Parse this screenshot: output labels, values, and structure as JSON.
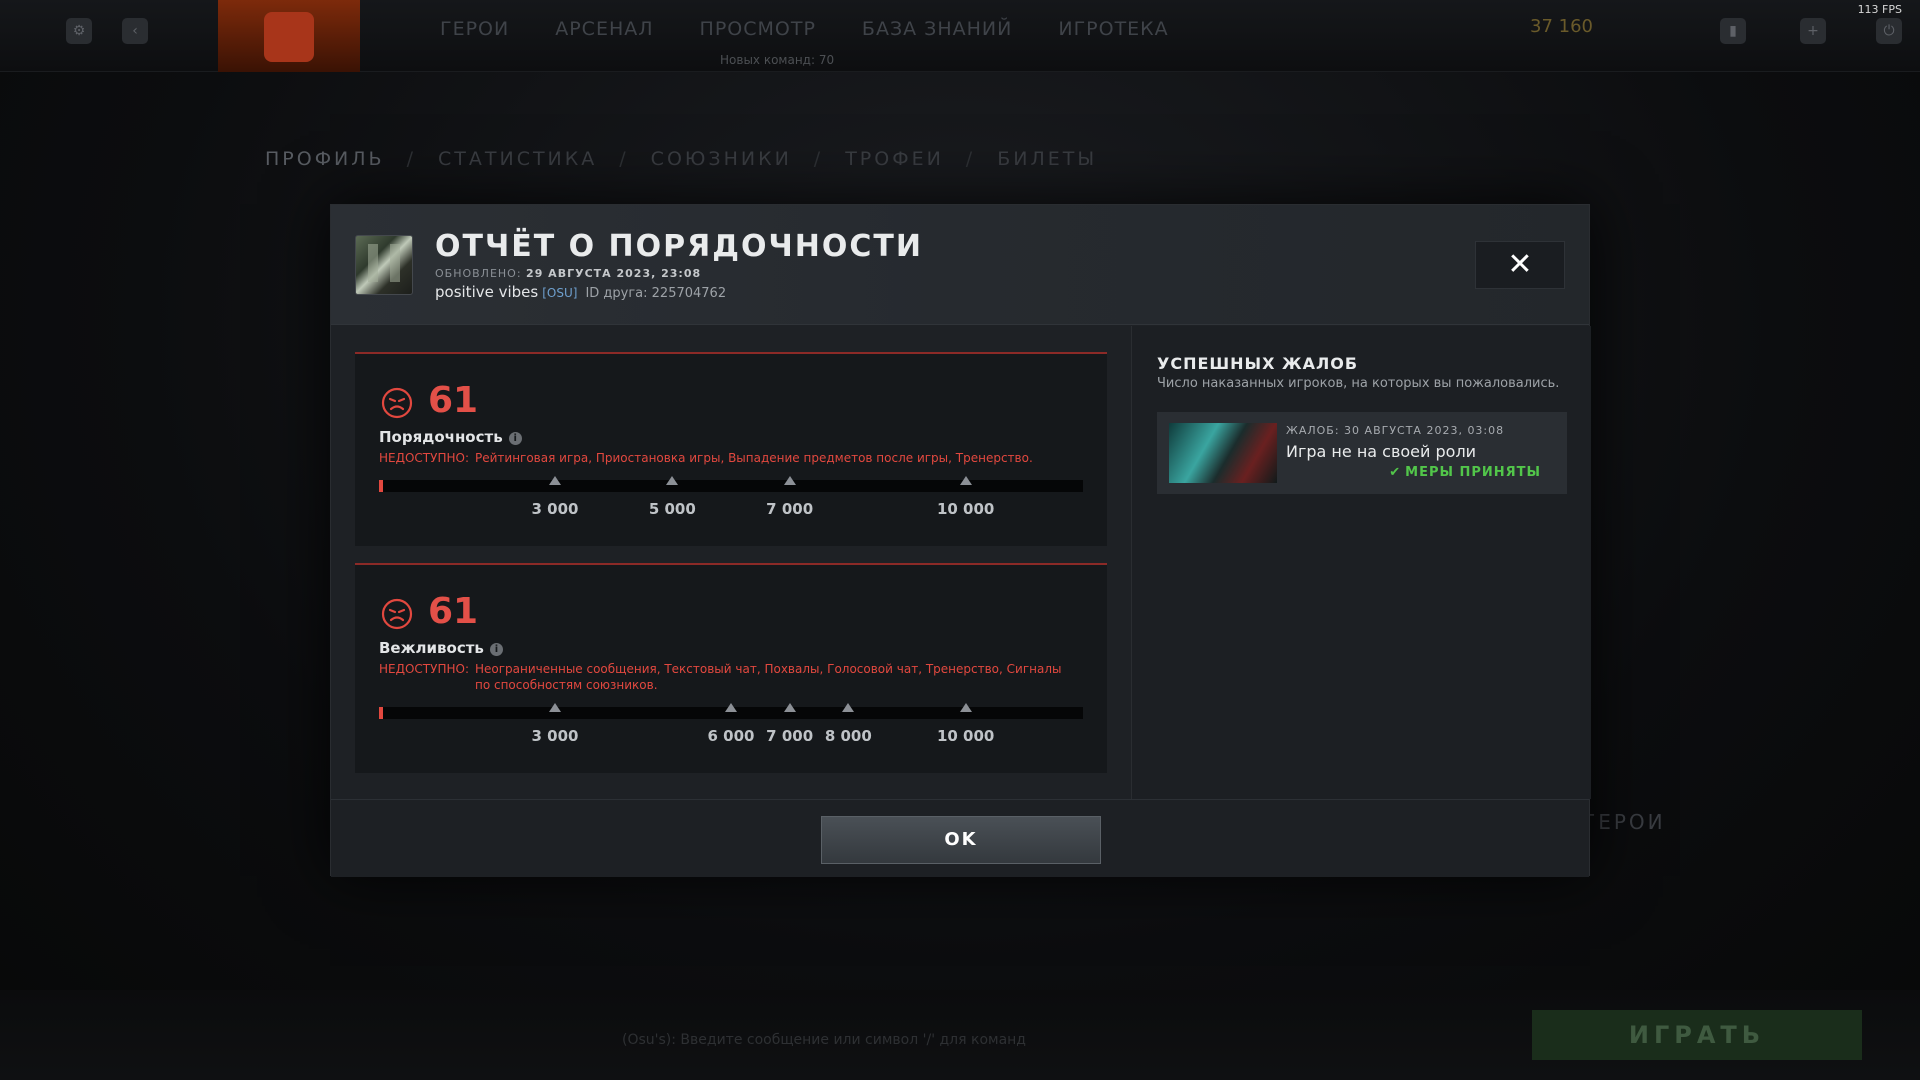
{
  "fps": "113 FPS",
  "background": {
    "nav": [
      "ГЕРОИ",
      "АРСЕНАЛ",
      "ПРОСМОТР",
      "БАЗА ЗНАНИЙ",
      "ИГРОТЕКА"
    ],
    "coins": "37  160",
    "new_teams": "Новых команд: 70",
    "profile_tabs": [
      "ПРОФИЛЬ",
      "СТАТИСТИКА",
      "СОЮЗНИКИ",
      "ТРОФЕИ",
      "БИЛЕТЫ"
    ],
    "heroes_title": "ГЕРОИ",
    "play_label": "ИГРАТЬ",
    "chat_placeholder": "(Osu's): Введите сообщение или символ '/' для команд"
  },
  "modal": {
    "title": "ОТЧЁТ О ПОРЯДОЧНОСТИ",
    "updated_label": "ОБНОВЛЕНО:",
    "updated_value": "29 АВГУСТА 2023, 23:08",
    "player_name": "positive vibes",
    "player_tag": "[OSU]",
    "friend_id": "ID друга: 225704762",
    "close_label": "✕",
    "ok_label": "OK"
  },
  "behavior": {
    "score": "61",
    "label": "Порядочность",
    "unavailable_label": "НЕДОСТУПНО:",
    "unavailable_text": "Рейтинговая игра, Приостановка игры, Выпадение предметов после игры, Тренерство.",
    "max": 12000,
    "value": 61,
    "ticks": [
      {
        "value": 3000,
        "label": "3 000"
      },
      {
        "value": 5000,
        "label": "5 000"
      },
      {
        "value": 7000,
        "label": "7 000"
      },
      {
        "value": 10000,
        "label": "10 000"
      }
    ]
  },
  "communication": {
    "score": "61",
    "label": "Вежливость",
    "unavailable_label": "НЕДОСТУПНО:",
    "unavailable_text": "Неограниченные сообщения, Текстовый чат, Похвалы, Голосовой чат, Тренерство, Сигналы по способностям союзников.",
    "max": 12000,
    "value": 61,
    "ticks": [
      {
        "value": 3000,
        "label": "3 000"
      },
      {
        "value": 6000,
        "label": "6 000"
      },
      {
        "value": 7000,
        "label": "7 000"
      },
      {
        "value": 8000,
        "label": "8 000"
      },
      {
        "value": 10000,
        "label": "10 000"
      }
    ]
  },
  "reports": {
    "title": "УСПЕШНЫХ ЖАЛОБ",
    "subtitle": "Число наказанных игроков, на которых вы пожаловались.",
    "items": [
      {
        "date": "ЖАЛОБ: 30 АВГУСТА 2023, 03:08",
        "reason": "Игра не на своей роли",
        "status": "МЕРЫ ПРИНЯТЫ"
      }
    ]
  },
  "colors": {
    "accent_red": "#e2483f",
    "success_green": "#52c64a"
  }
}
